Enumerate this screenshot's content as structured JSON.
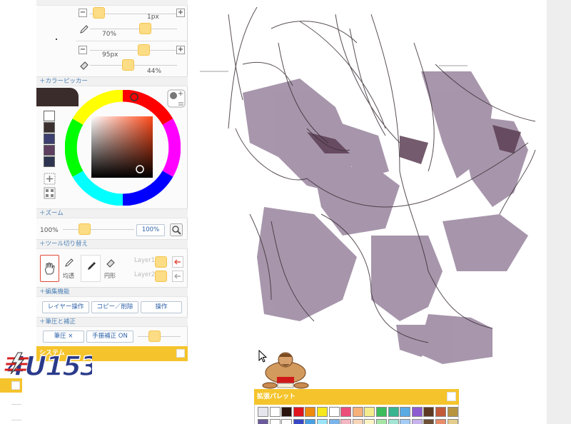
{
  "brush_panel": {
    "size_value": "1px",
    "opacity_value": "70%",
    "eraser_size_value": "95px",
    "eraser_opacity_value": "44%"
  },
  "color_picker": {
    "header": "＋カラーピッカー",
    "current_color": "#3a2c2a",
    "recent_colors": [
      "#ffffff",
      "#3b3030",
      "#3d3f70",
      "#5e3f60",
      "#2e3450"
    ]
  },
  "zoom": {
    "header": "＋ズーム",
    "left_value": "100%",
    "field_value": "100%"
  },
  "tool_switch": {
    "header": "＋ツール切り替え",
    "tool1_label": "均透",
    "tool2_label": "円形",
    "layer1": "Layer1",
    "layer2": "Layer2"
  },
  "edit": {
    "header": "＋編集機能",
    "btn1": "レイヤー操作",
    "btn2": "コピー／削除",
    "btn3": "操作"
  },
  "pressure": {
    "header": "＋筆圧と補正",
    "btn1": "筆圧 ×",
    "btn2": "手振補正 ON"
  },
  "system": {
    "title": "システム"
  },
  "palette": {
    "title": "拡張パレット",
    "row1": [
      "#e6e6ee",
      "#ffffff",
      "#2a140e",
      "#e0141e",
      "#ee8a0e",
      "#f6e81c",
      "#ffffff",
      "#ec4e7a",
      "#f6b07a",
      "#f4ec8c",
      "#3cbc5c",
      "#38b490",
      "#5aaae4",
      "#8c5cd0",
      "#5e3a22",
      "#c05a3a",
      "#b89440"
    ],
    "row2": [
      "#6a5a9a",
      "#ffffff",
      "#ffffff",
      "#3848c4",
      "#4aa0e0",
      "#9ce4fa",
      "#7ab4ea",
      "#f4b8c4",
      "#f6d4b8",
      "#fcf4c4",
      "#a6e4a6",
      "#a4e4d4",
      "#a4ccf4",
      "#c8b4ec",
      "#6e5036",
      "#e88c6a",
      "#e4cc8c"
    ]
  },
  "colors": {
    "accent_yellow": "#f5c42c",
    "slider_knob": "#fcdc84",
    "header_text": "#4a7fb5"
  }
}
